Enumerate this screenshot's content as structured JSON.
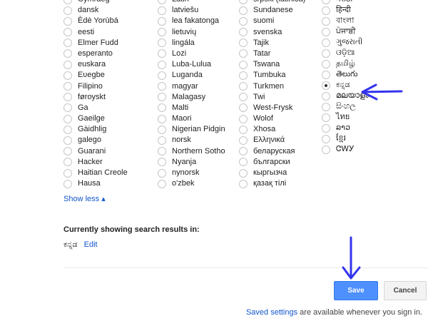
{
  "language_columns": [
    [
      "Cymraeg",
      "dansk",
      "Èdè Yorùbá",
      "eesti",
      "Elmer Fudd",
      "esperanto",
      "euskara",
      "Eʋegbe",
      "Filipino",
      "føroyskt",
      "Ga",
      "Gaeilge",
      "Gàidhlig",
      "galego",
      "Guarani",
      "Hacker",
      "Haitian Creole",
      "Hausa"
    ],
    [
      "Latin",
      "latviešu",
      "lea fakatonga",
      "lietuvių",
      "lingála",
      "Lozi",
      "Luba-Lulua",
      "Luganda",
      "magyar",
      "Malagasy",
      "Malti",
      "Maori",
      "Nigerian Pidgin",
      "norsk",
      "Northern Sotho",
      "Nyanja",
      "nynorsk",
      "o'zbek"
    ],
    [
      "srpski (latinica)",
      "Sundanese",
      "suomi",
      "svenska",
      "Tajik",
      "Tatar",
      "Tswana",
      "Tumbuka",
      "Turkmen",
      "Twi",
      "West-Frysk",
      "Wolof",
      "Xhosa",
      "Ελληνικά",
      "беларуская",
      "български",
      "кыргызча",
      "қазақ тілі"
    ],
    [
      "मराठी",
      "हिन्दी",
      "বাংলা",
      "ਪੰਜਾਬੀ",
      "ગુજરાતી",
      "ଓଡ଼ିଆ",
      "தமிழ்",
      "తెలుగు",
      "ಕನ್ನಡ",
      "മലയാളം",
      "සිංහල",
      "ไทย",
      "ລາວ",
      "ខ្មែរ",
      "ᏣᎳᎩ"
    ]
  ],
  "selected_language": "ಕನ್ನಡ",
  "show_less_label": "Show less ▴",
  "current_heading": "Currently showing search results in:",
  "current_language": "ಕನ್ನಡ",
  "edit_label": "Edit",
  "save_label": "Save",
  "cancel_label": "Cancel",
  "footer": {
    "link": "Saved settings",
    "text": " are available whenever you sign in."
  },
  "colors": {
    "link": "#1155cc",
    "save_button": "#4d90fe",
    "annotation_arrow": "#3333ee"
  },
  "icons": [
    "radio-button-icon",
    "annotation-arrow-icon"
  ]
}
